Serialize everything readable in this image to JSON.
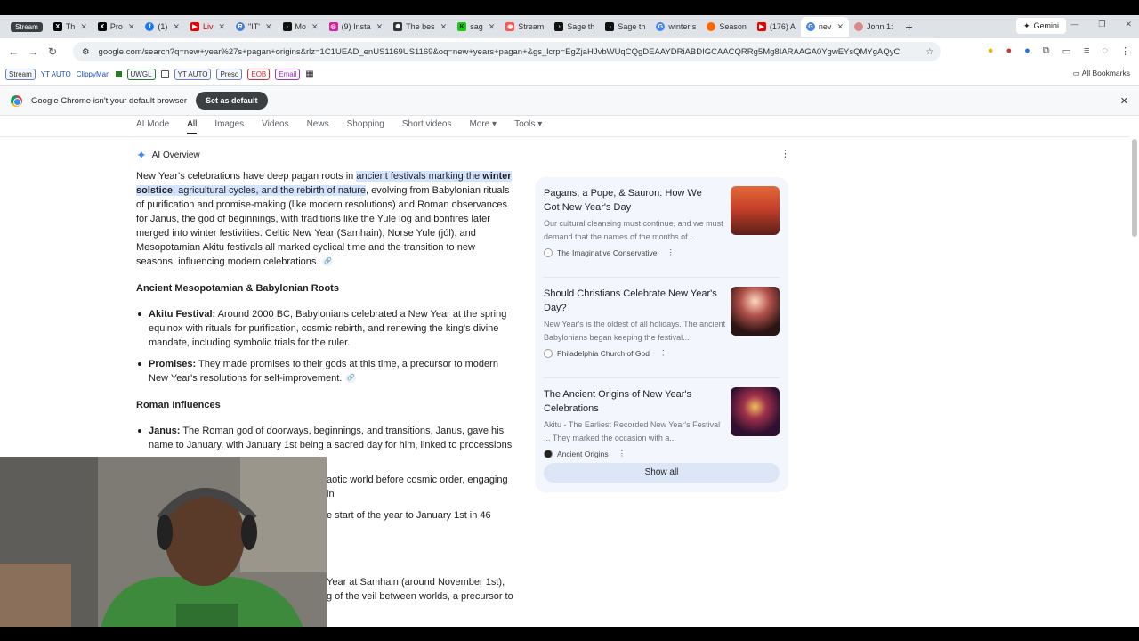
{
  "tabs": [
    {
      "label": "Stream",
      "kind": "group"
    },
    {
      "label": "Th",
      "icon": "x-icon"
    },
    {
      "label": "Pro",
      "icon": "x-icon"
    },
    {
      "label": "(1)",
      "icon": "facebook-icon"
    },
    {
      "label": "Liv",
      "icon": "youtube-icon"
    },
    {
      "label": "\"IT'",
      "icon": "r-icon"
    },
    {
      "label": "Mo",
      "icon": "tiktok-icon"
    },
    {
      "label": "(9) Insta",
      "icon": "instagram-icon"
    },
    {
      "label": "The bes",
      "icon": "chatgpt-icon"
    },
    {
      "label": "sag",
      "icon": "kick-icon"
    },
    {
      "label": "Stream",
      "icon": "streamlabs-icon"
    },
    {
      "label": "Sage th",
      "icon": "tiktok-icon"
    },
    {
      "label": "Sage th",
      "icon": "tiktok-icon"
    },
    {
      "label": "winter s",
      "icon": "google-icon"
    },
    {
      "label": "Season",
      "icon": "orange-icon"
    },
    {
      "label": "(176) A",
      "icon": "youtube-icon"
    },
    {
      "label": "nev",
      "icon": "google-icon",
      "active": true
    },
    {
      "label": "John 1:",
      "icon": "bible-icon"
    }
  ],
  "gemini_label": "Gemini",
  "address_url": "google.com/search?q=new+year%27s+pagan+origins&rlz=1C1UEAD_enUS1169US1169&oq=new+years+pagan+&gs_lcrp=EgZjaHJvbWUqCQgDEAAYDRiABDIGCAACQRRg5Mg8IARAAGA0YgwEYsQMYgAQyCAgCEAAYAxgN...",
  "bookmarks": [
    "Stream",
    "YT AUTO",
    "ClippyMan",
    "UWGL",
    "YT AUTO",
    "Preso",
    "EOB",
    "Email"
  ],
  "all_bookmarks": "All Bookmarks",
  "infobar": {
    "text": "Google Chrome isn't your default browser",
    "button": "Set as default"
  },
  "search_tabs": [
    "AI Mode",
    "All",
    "Images",
    "Videos",
    "News",
    "Shopping",
    "Short videos",
    "More",
    "Tools"
  ],
  "ai_overview_label": "AI Overview",
  "intro": {
    "p1": "New Year's celebrations have deep pagan roots in ",
    "hl1": "ancient festivals marking the ",
    "hl_bold": "winter solstice",
    "hl2": ", agricultural cycles, and the rebirth of nature",
    "p2": ", evolving from Babylonian rituals of purification and promise-making (like modern resolutions) and Roman observances for Janus, the god of beginnings, with traditions like the Yule log and bonfires later merged into winter festivities. Celtic New Year (Samhain), Norse Yule (jól), and Mesopotamian Akitu festivals all marked cyclical time and the transition to new seasons, influencing modern celebrations."
  },
  "section1": {
    "heading": "Ancient Mesopotamian & Babylonian Roots",
    "items": [
      {
        "term": "Akitu Festival:",
        "text": " Around 2000 BC, Babylonians celebrated a New Year at the spring equinox with rituals for purification, cosmic rebirth, and renewing the king's divine mandate, including symbolic trials for the ruler."
      },
      {
        "term": "Promises:",
        "text": " They made promises to their gods at this time, a precursor to modern New Year's resolutions for self-improvement."
      }
    ]
  },
  "section2": {
    "heading": "Roman Influences",
    "items": [
      {
        "term": "Janus:",
        "text": " The Roman god of doorways, beginnings, and transitions, Janus, gave his name to January, with January 1st being a sacred day for him, linked to processions"
      }
    ],
    "partial": [
      "aotic world before cosmic order, engaging in",
      "e start of the year to January 1st in 46",
      "Year at Samhain (around November 1st),",
      "g of the veil between worlds, a precursor to"
    ]
  },
  "sources": [
    {
      "title": "Pagans, a Pope, & Sauron: How We Got New Year's Day",
      "snippet": "Our cultural cleansing must continue, and we must demand that the names of the months of...",
      "source": "The Imaginative Conservative"
    },
    {
      "title": "Should Christians Celebrate New Year's Day?",
      "snippet": "New Year's is the oldest of all holidays. The ancient Babylonians began keeping the festival...",
      "source": "Philadelphia Church of God"
    },
    {
      "title": "The Ancient Origins of New Year's Celebrations",
      "snippet": "Akitu - The Earliest Recorded New Year's Festival ... They marked the occasion with a...",
      "source": "Ancient Origins"
    }
  ],
  "show_all": "Show all"
}
